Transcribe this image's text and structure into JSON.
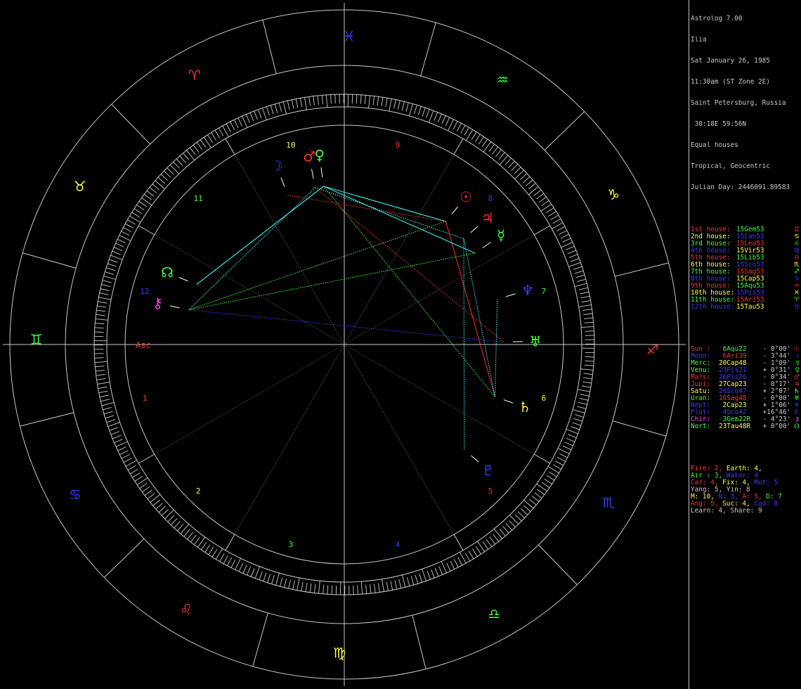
{
  "app": {
    "title": "Astrolog 7.00"
  },
  "chart_info": {
    "name": "Ilia",
    "date": "Sat January 26, 1985",
    "time": "11:30am (ST Zone 2E)",
    "place": "Saint Petersburg, Russia",
    "coords": " 30:18E 59:56N",
    "house_system": "Equal houses",
    "zodiac": "Tropical, Geocentric",
    "julian": "Julian Day: 2446091.89583"
  },
  "colors": {
    "red": "#ff3030",
    "orange": "#ffff40",
    "green": "#40ff40",
    "cyan": "#40ffff",
    "blue": "#3a3aff",
    "magenta": "#ff40ff",
    "yellow": "#ffff40",
    "white": "#ffffff",
    "gray": "#a0a0a0",
    "fire": "#ff3030",
    "earth": "#ffff40",
    "air": "#40ff40",
    "water": "#3a3aff"
  },
  "houses": [
    {
      "label": "1st house:",
      "pos": "15Gem53",
      "sign_icon": "gemini-icon",
      "sym": "♊",
      "color": "#ff3030",
      "poscolor": "#40ff40"
    },
    {
      "label": "2nd house:",
      "pos": "15Can53",
      "sign_icon": "cancer-icon",
      "sym": "♋",
      "color": "#ffff40",
      "poscolor": "#3a3aff"
    },
    {
      "label": "3rd house:",
      "pos": "15Leo53",
      "sign_icon": "leo-icon",
      "sym": "♌",
      "color": "#40ff40",
      "poscolor": "#ff3030"
    },
    {
      "label": "4th house:",
      "pos": "15Vir53",
      "sign_icon": "virgo-icon",
      "sym": "♍",
      "color": "#3a3aff",
      "poscolor": "#ffff40"
    },
    {
      "label": "5th house:",
      "pos": "15Lib53",
      "sign_icon": "libra-icon",
      "sym": "♎",
      "color": "#ff3030",
      "poscolor": "#40ff40"
    },
    {
      "label": "6th house:",
      "pos": "15Sco53",
      "sign_icon": "scorpio-icon",
      "sym": "♏",
      "color": "#ffff40",
      "poscolor": "#3a3aff"
    },
    {
      "label": "7th house:",
      "pos": "15Sag53",
      "sign_icon": "sagittarius-icon",
      "sym": "♐",
      "color": "#40ff40",
      "poscolor": "#ff3030"
    },
    {
      "label": "8th house:",
      "pos": "15Cap53",
      "sign_icon": "capricorn-icon",
      "sym": "♑",
      "color": "#3a3aff",
      "poscolor": "#ffff40"
    },
    {
      "label": "9th house:",
      "pos": "15Aqu53",
      "sign_icon": "aquarius-icon",
      "sym": "♒",
      "color": "#ff3030",
      "poscolor": "#40ff40"
    },
    {
      "label": "10th house:",
      "pos": "15Pis53",
      "sign_icon": "pisces-icon",
      "sym": "♓",
      "color": "#ffff40",
      "poscolor": "#3a3aff"
    },
    {
      "label": "11th house:",
      "pos": "15Ari53",
      "sign_icon": "aries-icon",
      "sym": "♈",
      "color": "#40ff40",
      "poscolor": "#ff3030"
    },
    {
      "label": "12th house:",
      "pos": "15Tau53",
      "sign_icon": "taurus-icon",
      "sym": "♉",
      "color": "#3a3aff",
      "poscolor": "#ffff40"
    }
  ],
  "planets": [
    {
      "label": "Sun :",
      "pos": " 6Aqu22",
      "aspect": " - 0°00'",
      "icon": "sun-icon",
      "sym": "☉",
      "color": "#ff3030",
      "poscolor": "#40ff40"
    },
    {
      "label": "Moon:",
      "pos": " 6Ari39",
      "aspect": " - 3°44'",
      "icon": "moon-icon",
      "sym": "☽",
      "color": "#3a3aff",
      "poscolor": "#ff3030"
    },
    {
      "label": "Merc:",
      "pos": "20Cap48",
      "aspect": " - 1°09'",
      "icon": "mercury-icon",
      "sym": "☿",
      "color": "#40ff40",
      "poscolor": "#ffff40"
    },
    {
      "label": "Venu:",
      "pos": "23Pis21",
      "aspect": " + 0°31'",
      "icon": "venus-icon",
      "sym": "♀",
      "color": "#40ff40",
      "poscolor": "#3a3aff"
    },
    {
      "label": "Mars:",
      "pos": "26Pis26",
      "aspect": " - 0°34'",
      "icon": "mars-icon",
      "sym": "♂",
      "color": "#ff3030",
      "poscolor": "#3a3aff"
    },
    {
      "label": "Jupi:",
      "pos": "27Cap23",
      "aspect": " - 0°17'",
      "icon": "jupiter-icon",
      "sym": "♃",
      "color": "#ff3030",
      "poscolor": "#ffff40"
    },
    {
      "label": "Satu:",
      "pos": "26Sco47",
      "aspect": " + 2°07'",
      "icon": "saturn-icon",
      "sym": "♄",
      "color": "#ffff40",
      "poscolor": "#3a3aff"
    },
    {
      "label": "Uran:",
      "pos": "16Sag48",
      "aspect": " - 0°00'",
      "icon": "uranus-icon",
      "sym": "♅",
      "color": "#40ff40",
      "poscolor": "#ff3030"
    },
    {
      "label": "Nept:",
      "pos": " 2Cap23",
      "aspect": " + 1°06'",
      "icon": "neptune-icon",
      "sym": "♆",
      "color": "#3a3aff",
      "poscolor": "#ffff40"
    },
    {
      "label": "Plut:",
      "pos": " 4Sco42",
      "aspect": " +16°46'",
      "icon": "pluto-icon",
      "sym": "♇",
      "color": "#3a3aff",
      "poscolor": "#3a3aff"
    },
    {
      "label": "Chir:",
      "pos": " 3Gem22R",
      "aspect": " - 4°23'",
      "icon": "chiron-icon",
      "sym": "⚷",
      "color": "#ff40ff",
      "poscolor": "#40ff40"
    },
    {
      "label": "Nort:",
      "pos": "23Tau48R",
      "aspect": " + 0°00'",
      "icon": "north-node-icon",
      "sym": "☊",
      "color": "#40ff40",
      "poscolor": "#ffff40"
    }
  ],
  "summary": [
    [
      {
        "t": "Fire: 2, ",
        "c": "#ff3030"
      },
      {
        "t": "Earth: 4,",
        "c": "#ffff40"
      }
    ],
    [
      {
        "t": "Air : 3, ",
        "c": "#40ff40"
      },
      {
        "t": "Water: 4",
        "c": "#3a3aff"
      }
    ],
    [
      {
        "t": "Car: 4, ",
        "c": "#ff3030"
      },
      {
        "t": "Fix: 4, ",
        "c": "#ffff40"
      },
      {
        "t": "Mut: 5",
        "c": "#3a3aff"
      }
    ],
    [
      {
        "t": "Yang: 5, Yin: 8",
        "c": "#c8c8c8"
      }
    ],
    [
      {
        "t": "M: 10, ",
        "c": "#ffff40"
      },
      {
        "t": "N: 3, ",
        "c": "#3a3aff"
      },
      {
        "t": "A: 5, ",
        "c": "#ff3030"
      },
      {
        "t": "D: 7",
        "c": "#40ff40"
      }
    ],
    [
      {
        "t": "Ang: 5, ",
        "c": "#ff3030"
      },
      {
        "t": "Suc: 4, ",
        "c": "#ffff40"
      },
      {
        "t": "Cad: 8",
        "c": "#3a3aff"
      }
    ],
    [
      {
        "t": "Learn: 4, Share: 9",
        "c": "#c8c8c8"
      }
    ]
  ],
  "wheel": {
    "zodiac_signs": [
      {
        "sym": "♊",
        "icon": "gemini-icon",
        "color": "#40ff40",
        "lon": 75
      },
      {
        "sym": "♉",
        "icon": "taurus-icon",
        "color": "#ffff40",
        "lon": 45
      },
      {
        "sym": "♈",
        "icon": "aries-icon",
        "color": "#ff3030",
        "lon": 15
      },
      {
        "sym": "♓",
        "icon": "pisces-icon",
        "color": "#3a3aff",
        "lon": 345
      },
      {
        "sym": "♒",
        "icon": "aquarius-icon",
        "color": "#40ff40",
        "lon": 315
      },
      {
        "sym": "♑",
        "icon": "capricorn-icon",
        "color": "#ffff40",
        "lon": 285
      },
      {
        "sym": "♐",
        "icon": "sagittarius-icon",
        "color": "#ff3030",
        "lon": 255
      },
      {
        "sym": "♏",
        "icon": "scorpio-icon",
        "color": "#3a3aff",
        "lon": 225
      },
      {
        "sym": "♎",
        "icon": "libra-icon",
        "color": "#40ff40",
        "lon": 195
      },
      {
        "sym": "♍",
        "icon": "virgo-icon",
        "color": "#ffff40",
        "lon": 165
      },
      {
        "sym": "♌",
        "icon": "leo-icon",
        "color": "#ff3030",
        "lon": 135
      },
      {
        "sym": "♋",
        "icon": "cancer-icon",
        "color": "#3a3aff",
        "lon": 105
      }
    ],
    "house_numbers": [
      {
        "n": "1",
        "color": "#ff3030"
      },
      {
        "n": "2",
        "color": "#ffff40"
      },
      {
        "n": "3",
        "color": "#40ff40"
      },
      {
        "n": "4",
        "color": "#3a3aff"
      },
      {
        "n": "5",
        "color": "#ff3030"
      },
      {
        "n": "6",
        "color": "#ffff40"
      },
      {
        "n": "7",
        "color": "#40ff40"
      },
      {
        "n": "8",
        "color": "#3a3aff"
      },
      {
        "n": "9",
        "color": "#ff3030"
      },
      {
        "n": "10",
        "color": "#ffff40"
      },
      {
        "n": "11",
        "color": "#40ff40"
      },
      {
        "n": "12",
        "color": "#3a3aff"
      }
    ],
    "asc_label": "Asc",
    "asc_color": "#ff3030",
    "asc_lon": 75.883,
    "planet_lons": [
      {
        "sym": "☉",
        "icon": "sun-icon",
        "color": "#ff3030",
        "lon": 306.37
      },
      {
        "sym": "☽",
        "icon": "moon-icon",
        "color": "#3a3aff",
        "lon": 6.65
      },
      {
        "sym": "☿",
        "icon": "mercury-icon",
        "color": "#40ff40",
        "lon": 290.8
      },
      {
        "sym": "♀",
        "icon": "venus-icon",
        "color": "#40ff40",
        "lon": 353.35
      },
      {
        "sym": "♂",
        "icon": "mars-icon",
        "color": "#ff3030",
        "lon": 356.43
      },
      {
        "sym": "♃",
        "icon": "jupiter-icon",
        "color": "#ff3030",
        "lon": 297.38
      },
      {
        "sym": "♄",
        "icon": "saturn-icon",
        "color": "#ffff40",
        "lon": 236.78
      },
      {
        "sym": "♅",
        "icon": "uranus-icon",
        "color": "#40ff40",
        "lon": 256.8
      },
      {
        "sym": "♆",
        "icon": "neptune-icon",
        "color": "#3a3aff",
        "lon": 272.38
      },
      {
        "sym": "♇",
        "icon": "pluto-icon",
        "color": "#3a3aff",
        "lon": 214.7
      },
      {
        "sym": "⚷",
        "icon": "chiron-icon",
        "color": "#ff40ff",
        "lon": 63.37
      },
      {
        "sym": "☊",
        "icon": "north-node-icon",
        "color": "#40ff40",
        "lon": 53.8
      }
    ],
    "aspects": [
      {
        "a": 0,
        "b": 6,
        "color": "#ff3030"
      },
      {
        "a": 3,
        "b": 0,
        "color": "#40ffff"
      },
      {
        "a": 3,
        "b": 2,
        "color": "#40ffff"
      },
      {
        "a": 3,
        "b": 6,
        "color": "#40ff40"
      },
      {
        "a": 3,
        "b": 11,
        "color": "#40ffff"
      },
      {
        "a": 4,
        "b": 5,
        "color": "#40ffff"
      },
      {
        "a": 4,
        "b": 7,
        "color": "#ff3030"
      },
      {
        "a": 1,
        "b": 0,
        "color": "#ff3030"
      },
      {
        "a": 0,
        "b": 10,
        "color": "#40ff40"
      },
      {
        "a": 2,
        "b": 10,
        "color": "#40ff40"
      },
      {
        "a": 10,
        "b": 7,
        "color": "#3a3aff"
      },
      {
        "a": 10,
        "b": 4,
        "color": "#40ffff"
      },
      {
        "a": 5,
        "b": 6,
        "color": "#40ffff"
      },
      {
        "a": 6,
        "b": 8,
        "color": "#40ffff"
      },
      {
        "a": 9,
        "b": 5,
        "color": "#40ffff"
      },
      {
        "a": 11,
        "b": 3,
        "color": "#40ffff"
      }
    ]
  }
}
